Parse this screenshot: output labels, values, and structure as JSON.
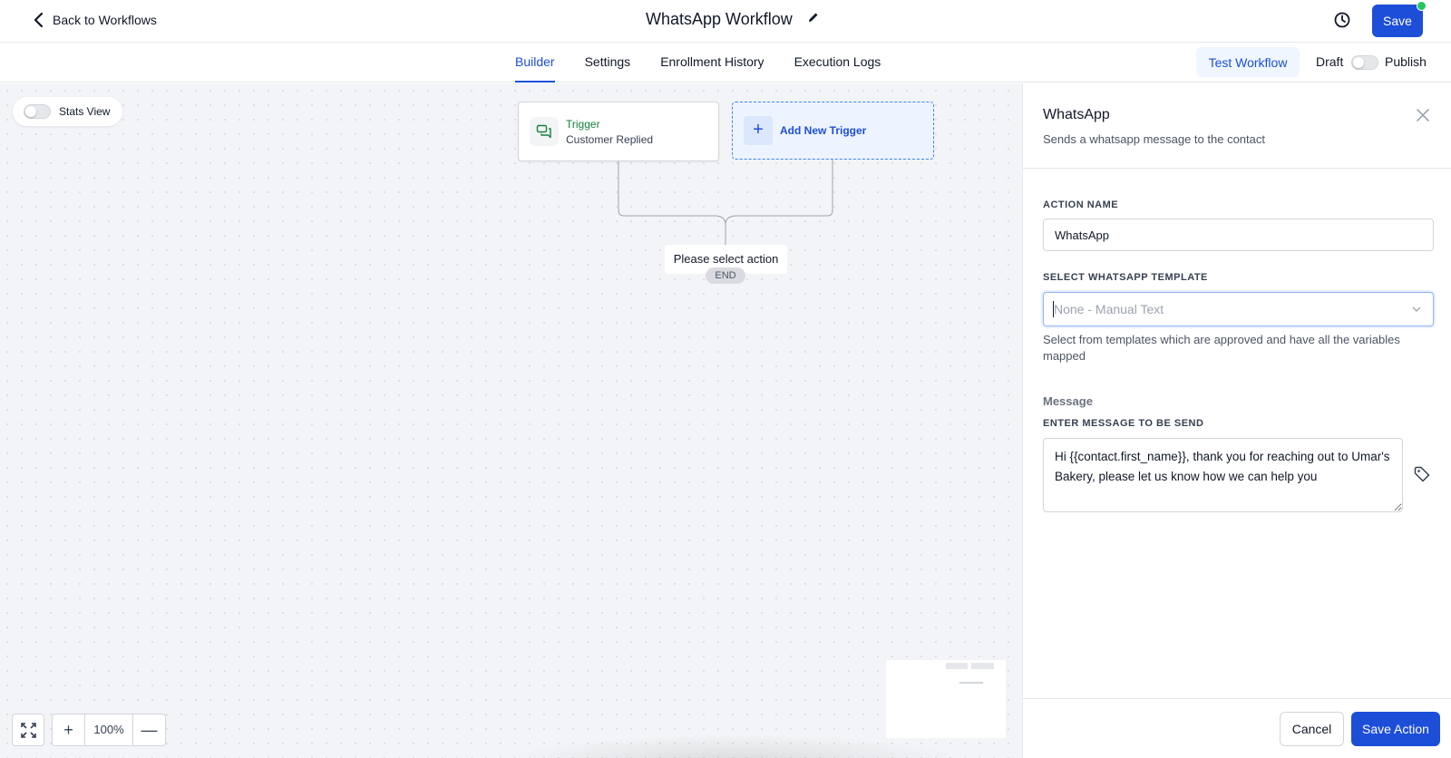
{
  "header": {
    "back_label": "Back to Workflows",
    "title": "WhatsApp Workflow",
    "save_label": "Save"
  },
  "tabs": [
    {
      "label": "Builder",
      "active": true
    },
    {
      "label": "Settings",
      "active": false
    },
    {
      "label": "Enrollment History",
      "active": false
    },
    {
      "label": "Execution Logs",
      "active": false
    }
  ],
  "actions": {
    "test_label": "Test Workflow",
    "draft_label": "Draft",
    "publish_label": "Publish"
  },
  "canvas": {
    "stats_label": "Stats View",
    "trigger": {
      "title": "Trigger",
      "subtitle": "Customer Replied"
    },
    "add_trigger_label": "Add New Trigger",
    "select_action_label": "Please select action",
    "end_label": "END",
    "zoom": "100%"
  },
  "panel": {
    "title": "WhatsApp",
    "subtitle": "Sends a whatsapp message to the contact",
    "action_name_label": "ACTION NAME",
    "action_name_value": "WhatsApp",
    "template_label": "SELECT WHATSAPP TEMPLATE",
    "template_placeholder": "None - Manual Text",
    "template_hint": "Select from templates which are approved and have all the variables mapped",
    "message_heading": "Message",
    "message_label": "ENTER MESSAGE TO BE SEND",
    "message_value": "Hi {{contact.first_name}}, thank you for reaching out to Umar's Bakery, please let us know how we can help you",
    "cancel_label": "Cancel",
    "save_action_label": "Save Action"
  },
  "colors": {
    "accent": "#1d4ed8",
    "trigger_green": "#15803d",
    "status_dot": "#22c55e"
  },
  "icons": [
    "chevron-left-icon",
    "pencil-icon",
    "history-icon",
    "chat-icon",
    "plus-icon",
    "close-icon",
    "chevron-down-icon",
    "tag-icon",
    "fit-view-icon",
    "minus-icon"
  ]
}
